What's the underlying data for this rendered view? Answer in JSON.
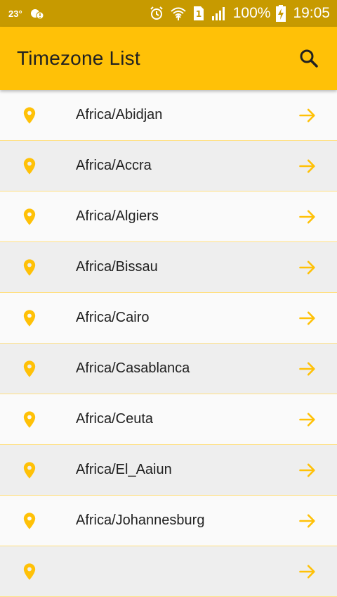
{
  "status_bar": {
    "temperature": "23°",
    "battery": "100%",
    "time": "19:05"
  },
  "app_bar": {
    "title": "Timezone List"
  },
  "colors": {
    "accent": "#FFC107",
    "status_bar": "#C79A00",
    "divider": "#FFE082"
  },
  "timezones": [
    {
      "label": "Africa/Abidjan"
    },
    {
      "label": "Africa/Accra"
    },
    {
      "label": "Africa/Algiers"
    },
    {
      "label": "Africa/Bissau"
    },
    {
      "label": "Africa/Cairo"
    },
    {
      "label": "Africa/Casablanca"
    },
    {
      "label": "Africa/Ceuta"
    },
    {
      "label": "Africa/El_Aaiun"
    },
    {
      "label": "Africa/Johannesburg"
    },
    {
      "label": ""
    }
  ]
}
